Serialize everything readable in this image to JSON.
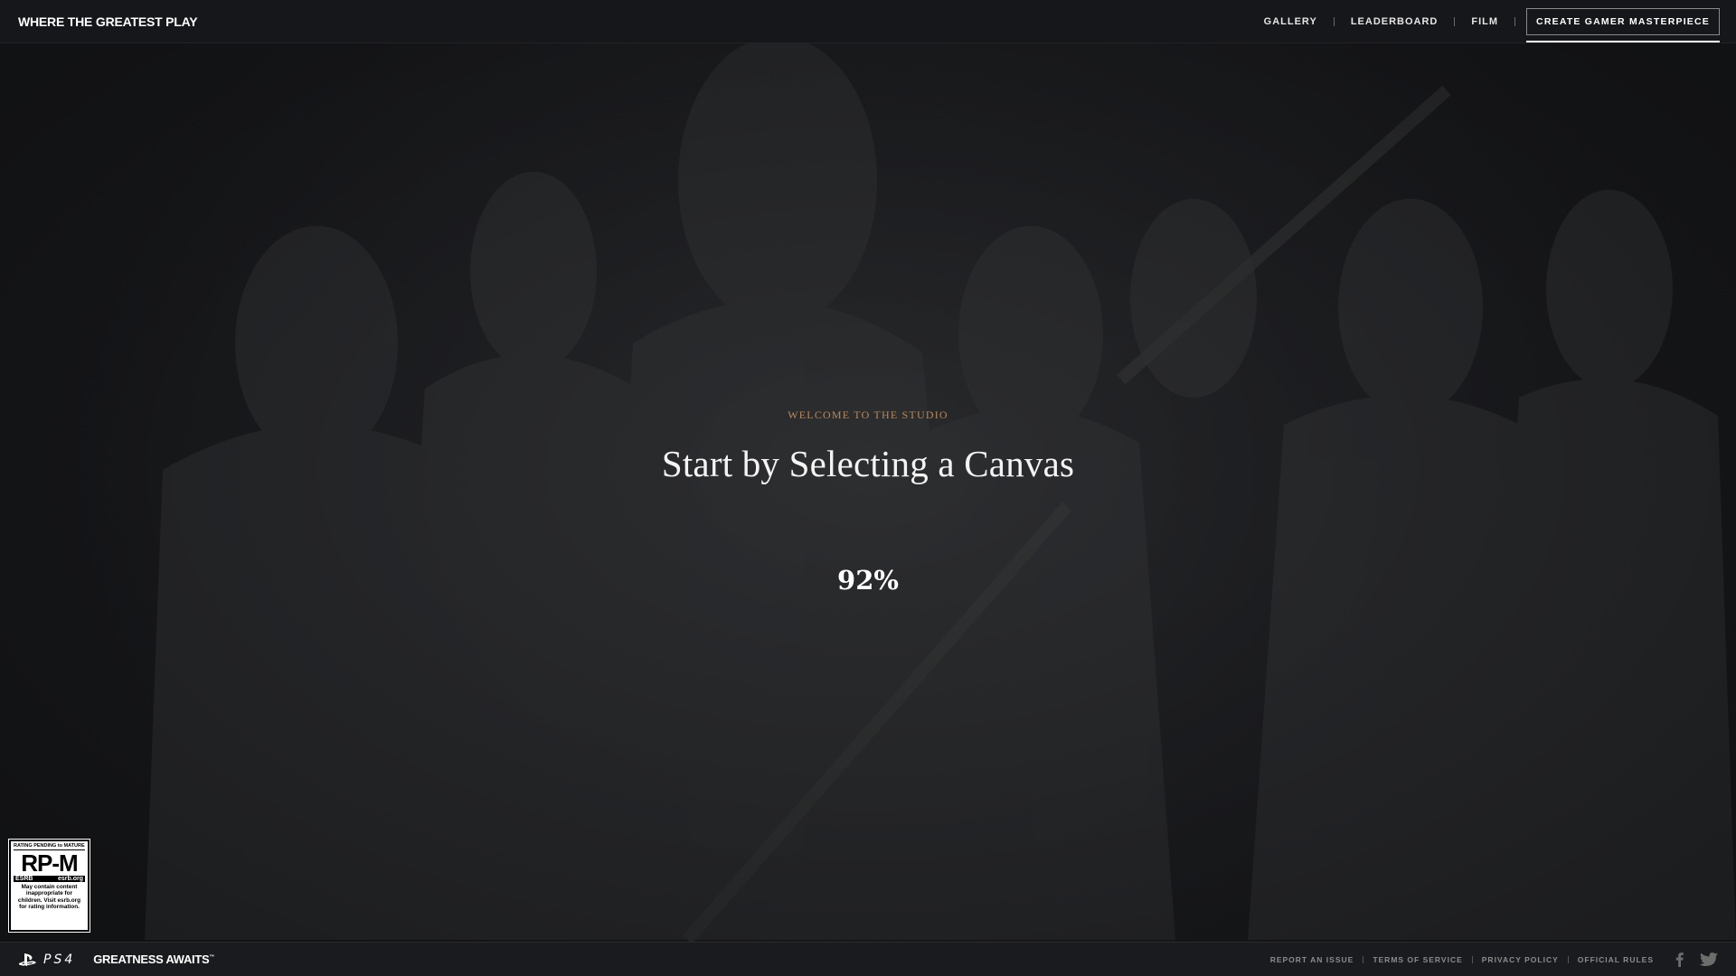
{
  "header": {
    "brand": "WHERE THE GREATEST PLAY",
    "nav": [
      {
        "label": "GALLERY"
      },
      {
        "label": "LEADERBOARD"
      },
      {
        "label": "FILM"
      }
    ],
    "cta_label": "CREATE GAMER MASTERPIECE"
  },
  "main": {
    "kicker": "WELCOME TO THE STUDIO",
    "headline": "Start by Selecting a Canvas",
    "progress_text": "92%",
    "progress_value": 0.92
  },
  "esrb": {
    "top": "RATING PENDING to MATURE 17+",
    "code": "RP-M",
    "brand": "ESRB",
    "site": "esrb.org",
    "desc": "May contain content inappropriate for children. Visit esrb.org for rating information."
  },
  "footer": {
    "platform": "PS4",
    "tagline": "GREATNESS AWAITS",
    "tagline_mark": "™",
    "links": [
      {
        "label": "REPORT AN ISSUE"
      },
      {
        "label": "TERMS OF SERVICE"
      },
      {
        "label": "PRIVACY POLICY"
      },
      {
        "label": "OFFICIAL RULES"
      }
    ],
    "social": [
      "facebook-icon",
      "twitter-icon"
    ]
  },
  "colors": {
    "background": "#1d1e21",
    "header_bg": "#16171a",
    "accent": "#b8895a",
    "text": "#ffffff"
  }
}
